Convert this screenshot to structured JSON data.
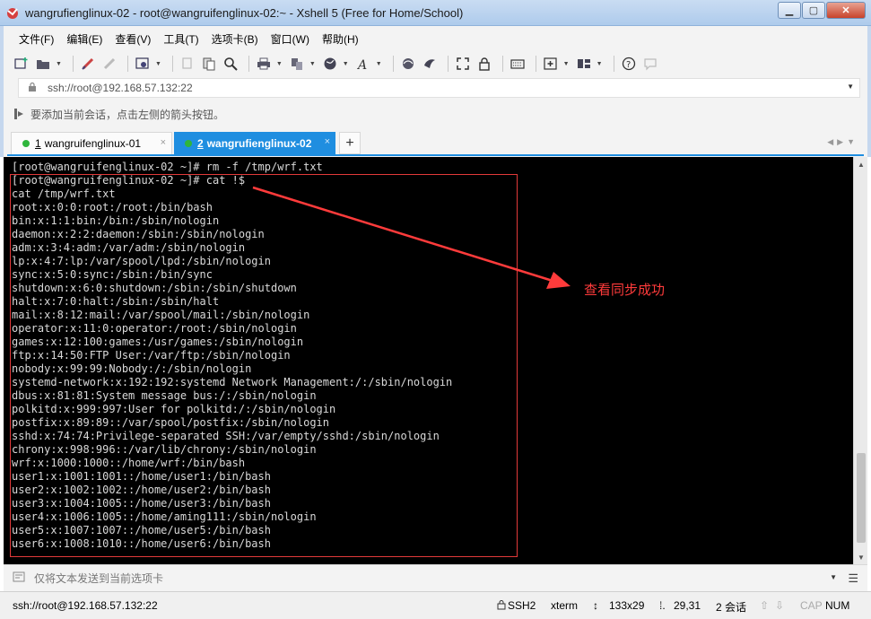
{
  "window": {
    "title": "wangrufienglinux-02 - root@wangruifenglinux-02:~ - Xshell 5 (Free for Home/School)",
    "minimize": "▁",
    "maximize": "▢",
    "close": "✕"
  },
  "menu": [
    "文件(F)",
    "编辑(E)",
    "查看(V)",
    "工具(T)",
    "选项卡(B)",
    "窗口(W)",
    "帮助(H)"
  ],
  "address": {
    "value": "ssh://root@192.168.57.132:22"
  },
  "hint": {
    "text": "要添加当前会话，点击左侧的箭头按钮。"
  },
  "tabs": [
    {
      "num": "1",
      "label": "wangruifenglinux-01",
      "close": "×"
    },
    {
      "num": "2",
      "label": "wangrufienglinux-02",
      "close": "×"
    }
  ],
  "tab_add": "+",
  "terminal": {
    "lines": [
      "[root@wangruifenglinux-02 ~]# rm -f /tmp/wrf.txt",
      "[root@wangruifenglinux-02 ~]# cat !$",
      "cat /tmp/wrf.txt",
      "root:x:0:0:root:/root:/bin/bash",
      "bin:x:1:1:bin:/bin:/sbin/nologin",
      "daemon:x:2:2:daemon:/sbin:/sbin/nologin",
      "adm:x:3:4:adm:/var/adm:/sbin/nologin",
      "lp:x:4:7:lp:/var/spool/lpd:/sbin/nologin",
      "sync:x:5:0:sync:/sbin:/bin/sync",
      "shutdown:x:6:0:shutdown:/sbin:/sbin/shutdown",
      "halt:x:7:0:halt:/sbin:/sbin/halt",
      "mail:x:8:12:mail:/var/spool/mail:/sbin/nologin",
      "operator:x:11:0:operator:/root:/sbin/nologin",
      "games:x:12:100:games:/usr/games:/sbin/nologin",
      "ftp:x:14:50:FTP User:/var/ftp:/sbin/nologin",
      "nobody:x:99:99:Nobody:/:/sbin/nologin",
      "systemd-network:x:192:192:systemd Network Management:/:/sbin/nologin",
      "dbus:x:81:81:System message bus:/:/sbin/nologin",
      "polkitd:x:999:997:User for polkitd:/:/sbin/nologin",
      "postfix:x:89:89::/var/spool/postfix:/sbin/nologin",
      "sshd:x:74:74:Privilege-separated SSH:/var/empty/sshd:/sbin/nologin",
      "chrony:x:998:996::/var/lib/chrony:/sbin/nologin",
      "wrf:x:1000:1000::/home/wrf:/bin/bash",
      "user1:x:1001:1001::/home/user1:/bin/bash",
      "user2:x:1002:1002::/home/user2:/bin/bash",
      "user3:x:1004:1005::/home/user3:/bin/bash",
      "user4:x:1006:1005::/home/aming111:/sbin/nologin",
      "user5:x:1007:1007::/home/user5:/bin/bash",
      "user6:x:1008:1010::/home/user6:/bin/bash"
    ],
    "annotation": "查看同步成功",
    "annotation_color": "#ff3b3b"
  },
  "input_bar": {
    "placeholder": "仅将文本发送到当前选项卡"
  },
  "status": {
    "connection": "ssh://root@192.168.57.132:22",
    "protocol": "SSH2",
    "term": "xterm",
    "size": "133x29",
    "cursor": "29,31",
    "sessions": "2 会话",
    "cap": "CAP",
    "num": "NUM"
  }
}
